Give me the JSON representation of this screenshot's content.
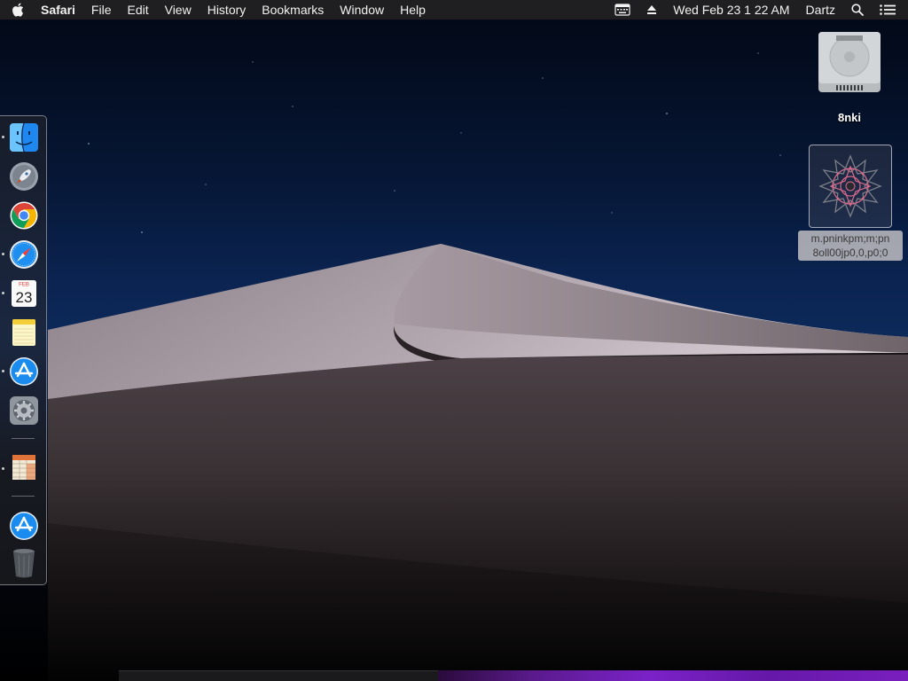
{
  "menubar": {
    "app_name": "Safari",
    "menus": [
      "File",
      "Edit",
      "View",
      "History",
      "Bookmarks",
      "Window",
      "Help"
    ],
    "status": {
      "datetime": "Wed Feb 23  1 22 AM",
      "user": "Dartz"
    },
    "icons": [
      "apple-icon",
      "keyboard-viewer-icon",
      "eject-icon",
      "spotlight-icon",
      "notification-center-icon"
    ]
  },
  "dock": {
    "items": [
      {
        "name": "finder",
        "icon": "finder-icon",
        "running": true
      },
      {
        "name": "launchpad",
        "icon": "rocket-icon",
        "running": false
      },
      {
        "name": "chrome",
        "icon": "chrome-icon",
        "running": false
      },
      {
        "name": "safari",
        "icon": "compass-icon",
        "running": true
      },
      {
        "name": "calendar",
        "icon": "calendar-icon",
        "running": true,
        "month": "FEB",
        "day": "23"
      },
      {
        "name": "notes",
        "icon": "notes-icon",
        "running": false
      },
      {
        "name": "app-store",
        "icon": "app-store-icon",
        "running": true
      },
      {
        "name": "system-preferences",
        "icon": "gear-icon",
        "running": false
      },
      {
        "name": "spreadsheet",
        "icon": "spreadsheet-icon",
        "running": true
      },
      {
        "name": "app-store-downloads",
        "icon": "app-store-icon",
        "running": false
      },
      {
        "name": "trash",
        "icon": "trash-icon",
        "running": false
      }
    ]
  },
  "desktop": {
    "hard_drive": {
      "label": "8nki",
      "icon": "hard-drive-icon"
    },
    "file": {
      "label_line1": "m.pninkpm;m;pn",
      "label_line2": "8oll00jp0,0,p0;0",
      "icon": "star-pattern-icon"
    }
  },
  "colors": {
    "menubar": "#202022",
    "sky_top": "#020714",
    "sky_mid": "#0d2a5a",
    "dune_light": "#b8aab2",
    "accent_purple": "#7b22c8"
  }
}
